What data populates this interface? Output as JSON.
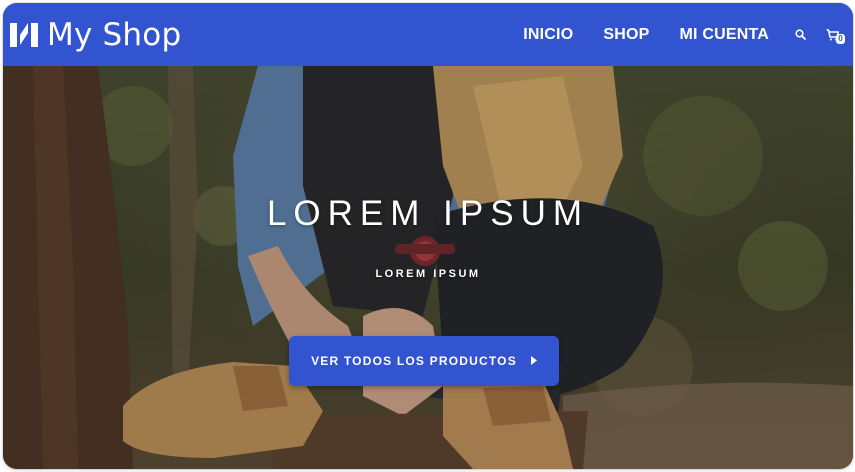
{
  "colors": {
    "brand_blue": "#3254d0",
    "text_on_brand": "#ffffff"
  },
  "header": {
    "logo_icon": "store-logo-icon",
    "brand_name": "My Shop",
    "nav": [
      {
        "label": "INICIO"
      },
      {
        "label": "SHOP"
      },
      {
        "label": "MI CUENTA"
      }
    ],
    "search_icon": "search-icon",
    "cart_icon": "cart-icon",
    "cart_count": "0"
  },
  "hero": {
    "title": "LOREM IPSUM",
    "subtitle": "LOREM IPSUM",
    "cta_label": "VER TODOS LOS PRODUCTOS",
    "cta_icon": "caret-right-icon",
    "background": "photo of person sitting on tree stump wearing boots and wristwatch in forest"
  }
}
